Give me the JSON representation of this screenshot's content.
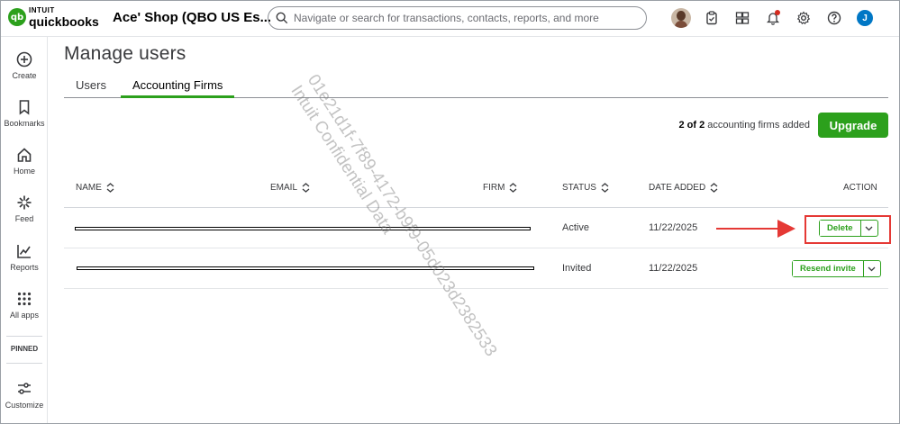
{
  "app": {
    "logo_small": "INTUIT",
    "logo_name": "quickbooks",
    "logo_mark": "qb",
    "company": "Ace' Shop (QBO US Es..."
  },
  "search": {
    "placeholder": "Navigate or search for transactions, contacts, reports, and more"
  },
  "header_icons": [
    "avatar-photo",
    "clipboard-icon",
    "apps-switch-icon",
    "bell-icon",
    "gear-icon",
    "help-icon",
    "user-avatar"
  ],
  "user_initial": "J",
  "sidebar": {
    "items": [
      {
        "label": "Create",
        "icon": "plus-circle-icon"
      },
      {
        "label": "Bookmarks",
        "icon": "bookmark-icon"
      },
      {
        "label": "Home",
        "icon": "home-icon"
      },
      {
        "label": "Feed",
        "icon": "sparkle-icon"
      },
      {
        "label": "Reports",
        "icon": "chart-icon"
      },
      {
        "label": "All apps",
        "icon": "grid-icon"
      }
    ],
    "pinned_label": "PINNED",
    "customize_label": "Customize"
  },
  "page": {
    "title": "Manage users",
    "tabs": [
      {
        "label": "Users",
        "active": false
      },
      {
        "label": "Accounting Firms",
        "active": true
      }
    ],
    "firms_count_bold": "2 of 2",
    "firms_count_rest": " accounting firms added",
    "upgrade_label": "Upgrade"
  },
  "table": {
    "columns": [
      "NAME",
      "EMAIL",
      "FIRM",
      "STATUS",
      "DATE ADDED",
      "ACTION"
    ],
    "rows": [
      {
        "status": "Active",
        "date_added": "11/22/2025",
        "action": "Delete"
      },
      {
        "status": "Invited",
        "date_added": "11/22/2025",
        "action": "Resend invite"
      }
    ]
  },
  "watermark": {
    "line1": "01e21d1f-7f89-4172-b9f9-05d023d2382533",
    "line2": "Intuit Confidential Data"
  },
  "colors": {
    "accent_green": "#2ca01c",
    "annotation_red": "#e53935",
    "notification_red": "#d52b1e",
    "user_blue": "#0077c5"
  }
}
